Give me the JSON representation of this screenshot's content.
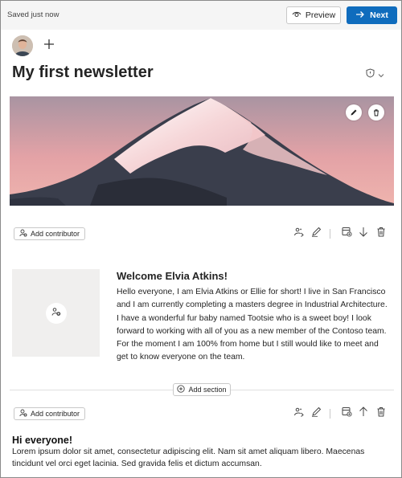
{
  "topbar": {
    "status": "Saved just now",
    "preview_label": "Preview",
    "next_label": "Next"
  },
  "newsletter": {
    "title": "My first newsletter"
  },
  "sections": {
    "contributor_label": "Add contributor",
    "add_section_label": "Add section"
  },
  "welcome": {
    "title": "Welcome Elvia Atkins!",
    "body": "Hello everyone, I am Elvia Atkins or Ellie for short! I live in San Francisco and I am currently completing a masters degree in Industrial Architecture. I have a wonderful fur baby named Tootsie who is a sweet boy! I look forward to working with all of you as a new member of the Contoso team. For the moment I am 100% from home but I still would like to meet and get to know everyone on the team."
  },
  "second": {
    "title": "Hi everyone!",
    "body": "Lorem ipsum dolor sit amet, consectetur adipiscing elit. Nam sit amet aliquam libero. Maecenas tincidunt vel orci eget lacinia. Sed gravida felis et dictum accumsan."
  },
  "colors": {
    "accent": "#0f6cbd",
    "topbar_bg": "#f5f5f5",
    "placeholder_bg": "#f0efee"
  },
  "icons": [
    "eye-icon",
    "arrow-right-icon",
    "plus-icon",
    "shield-icon",
    "chevron-down-icon",
    "pencil-icon",
    "trash-icon",
    "person-add-icon",
    "magic-icon",
    "pen-icon",
    "layout-add-icon",
    "arrow-down-icon",
    "arrow-up-icon",
    "image-add-icon"
  ]
}
